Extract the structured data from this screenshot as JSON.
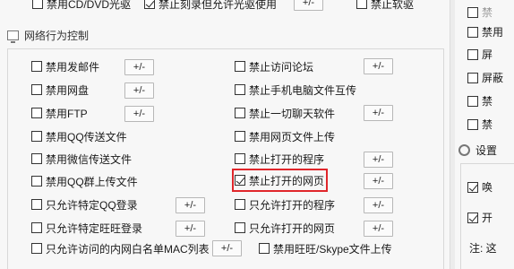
{
  "top_row": {
    "item1": "禁用CD/DVD光驱",
    "item2": "禁止刻录但允许光驱使用",
    "item2_checked": true,
    "btn": "+/-",
    "item3": "禁止软驱"
  },
  "section": {
    "title": "网络行为控制",
    "icon": "network-monitor-icon"
  },
  "left_col": [
    {
      "label": "禁用发邮件",
      "checked": false,
      "btn": "+/-"
    },
    {
      "label": "禁用网盘",
      "checked": false,
      "btn": "+/-"
    },
    {
      "label": "禁用FTP",
      "checked": false,
      "btn": "+/-"
    },
    {
      "label": "禁用QQ传送文件",
      "checked": false
    },
    {
      "label": "禁用微信传送文件",
      "checked": false
    },
    {
      "label": "禁用QQ群上传文件",
      "checked": false
    },
    {
      "label": "只允许特定QQ登录",
      "checked": false,
      "btn": "+/-"
    },
    {
      "label": "只允许特定旺旺登录",
      "checked": false,
      "btn": "+/-"
    },
    {
      "label": "只允许访问的内网白名单MAC列表",
      "checked": false,
      "btn": "+/-"
    }
  ],
  "right_col": [
    {
      "label": "禁止访问论坛",
      "checked": false,
      "btn": "+/-"
    },
    {
      "label": "禁止手机电脑文件互传",
      "checked": false
    },
    {
      "label": "禁止一切聊天软件",
      "checked": false,
      "btn": "+/-"
    },
    {
      "label": "禁用网页文件上传",
      "checked": false
    },
    {
      "label": "禁止打开的程序",
      "checked": false,
      "btn": "+/-"
    },
    {
      "label": "禁止打开的网页",
      "checked": true,
      "btn": "+/-"
    },
    {
      "label": "只允许打开的程序",
      "checked": false,
      "btn": "+/-"
    },
    {
      "label": "只允许打开的网页",
      "checked": false,
      "btn": "+/-"
    },
    {
      "label": "禁用旺旺/Skype文件上传",
      "checked": false
    }
  ],
  "right_panel": {
    "items": [
      "禁",
      "禁用",
      "屏",
      "屏蔽",
      "禁",
      "禁"
    ],
    "settings_label": "设置",
    "settings_icon": "gear-icon",
    "opt1": "唤",
    "opt2": "开",
    "note": "注: 这"
  },
  "colors": {
    "highlight": "#e0262b",
    "panel_bg": "#f7f7f7"
  }
}
